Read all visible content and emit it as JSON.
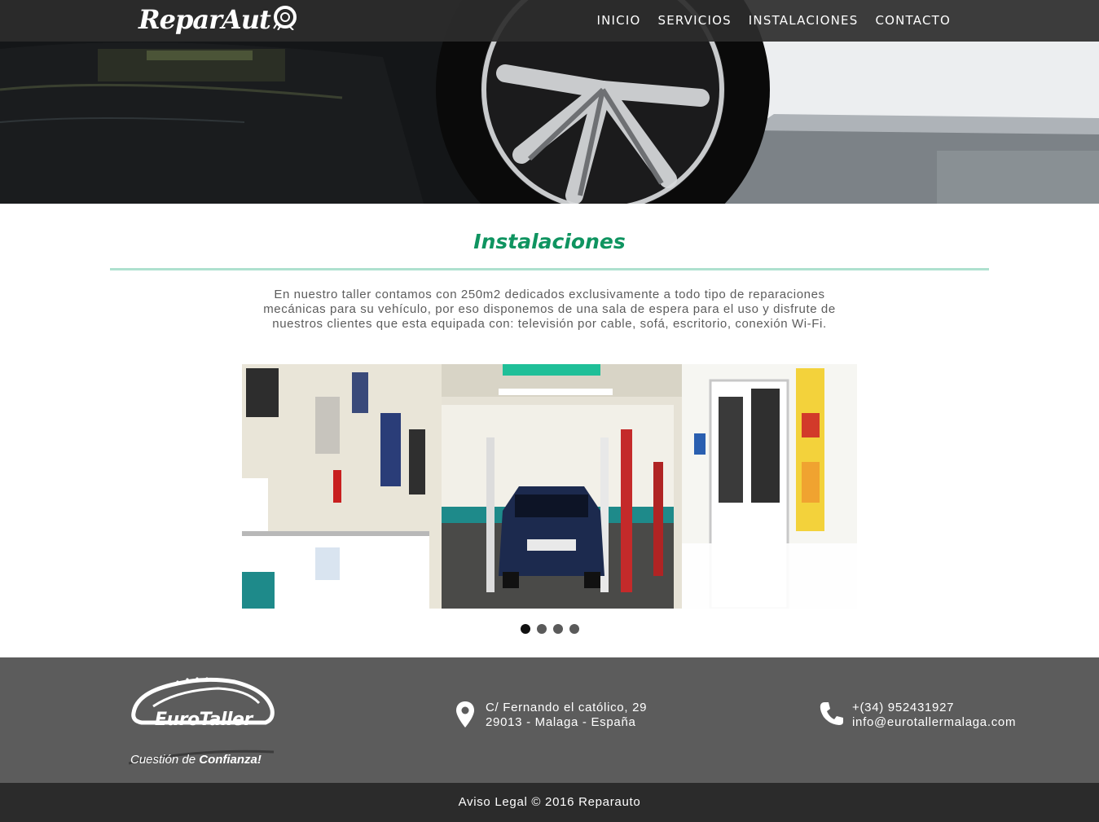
{
  "site": {
    "logo_text": "ReparAut"
  },
  "nav": {
    "items": [
      {
        "label": "INICIO"
      },
      {
        "label": "SERVICIOS"
      },
      {
        "label": "INSTALACIONES"
      },
      {
        "label": "CONTACTO"
      }
    ]
  },
  "section": {
    "title": "Instalaciones",
    "intro": "En nuestro taller contamos con 250m2 dedicados exclusivamente a todo tipo de reparaciones mecánicas para su vehículo, por eso disponemos de una sala de espera para el uso y disfrute de nuestros clientes que esta equipada con: televisión por cable, sofá, escritorio, conexión Wi-Fi."
  },
  "slider": {
    "slide_count": 4,
    "active_index": 0
  },
  "footer": {
    "brand_name": "EuroTaller",
    "brand_tagline_prefix": "Cuestión de ",
    "brand_tagline_bold": "Confianza!",
    "address_line1": "C/ Fernando el católico, 29",
    "address_line2": "29013 - Malaga - España",
    "phone": "+(34) 952431927",
    "email": "info@eurotallermalaga.com",
    "copyright": "Aviso Legal © 2016 Reparauto"
  },
  "icons": {
    "address": "map-pin-icon",
    "contact": "phone-icon"
  },
  "colors": {
    "title_green": "#0f9460",
    "divider_mint": "#aee1cf",
    "navbar": "#2d2d2d",
    "footer": "#5c5c5c",
    "bottom_bar": "#2b2b2b"
  }
}
